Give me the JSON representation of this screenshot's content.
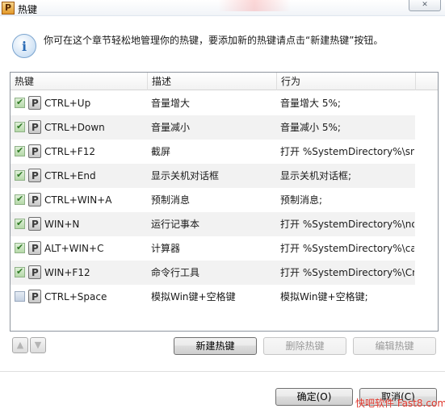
{
  "window": {
    "title": "热键",
    "close_icon": "close-icon"
  },
  "info": {
    "icon": "info-icon",
    "glyph": "i",
    "text": "你可在这个章节轻松地管理你的热键，要添加新的热键请点击“新建热键”按钮。"
  },
  "table": {
    "columns": [
      "热键",
      "描述",
      "行为"
    ],
    "rows": [
      {
        "enabled": true,
        "key": "CTRL+Up",
        "desc": "音量增大",
        "action": "音量增大 5%;"
      },
      {
        "enabled": true,
        "key": "CTRL+Down",
        "desc": "音量减小",
        "action": "音量减小 5%;"
      },
      {
        "enabled": true,
        "key": "CTRL+F12",
        "desc": "截屏",
        "action": "打开 %SystemDirectory%\\snip..."
      },
      {
        "enabled": true,
        "key": "CTRL+End",
        "desc": "显示关机对话框",
        "action": "显示关机对话框;"
      },
      {
        "enabled": true,
        "key": "CTRL+WIN+A",
        "desc": "预制消息",
        "action": "预制消息;"
      },
      {
        "enabled": true,
        "key": "WIN+N",
        "desc": "运行记事本",
        "action": "打开 %SystemDirectory%\\not..."
      },
      {
        "enabled": true,
        "key": "ALT+WIN+C",
        "desc": "计算器",
        "action": "打开 %SystemDirectory%\\calc..."
      },
      {
        "enabled": true,
        "key": "WIN+F12",
        "desc": "命令行工具",
        "action": "打开 %SystemDirectory%\\Cm..."
      },
      {
        "enabled": false,
        "key": "CTRL+Space",
        "desc": "模拟Win键+空格键",
        "action": "模拟Win键+空格键;"
      }
    ]
  },
  "toolbar": {
    "move_up_icon": "arrow-up-icon",
    "move_down_icon": "arrow-down-icon",
    "new_label": "新建热键",
    "delete_label": "删除热键",
    "edit_label": "编辑热键"
  },
  "footer": {
    "ok_label": "确定(O)",
    "cancel_label": "取消(C)",
    "watermark": "快吧软件 Fast8.com"
  },
  "colors": {
    "checkbox_on": "#2f7a25",
    "watermark": "#e0352a"
  }
}
